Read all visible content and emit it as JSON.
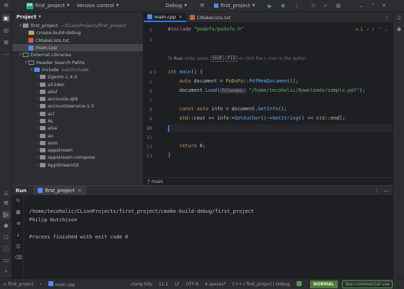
{
  "titlebar": {
    "project_badge": "FP",
    "project_name": "first_project",
    "vcs": "Version control",
    "config": "Debug",
    "run_target": "first_project"
  },
  "project_panel": {
    "title": "Project",
    "tree": [
      {
        "label": "first_project",
        "extra": "~/CLionProjects/first_project",
        "kind": "folder"
      },
      {
        "label": "cmake-build-debug",
        "kind": "folder-orange"
      },
      {
        "label": "CMakeLists.txt",
        "kind": "cmake"
      },
      {
        "label": "main.cpp",
        "kind": "cpp"
      },
      {
        "label": "External Libraries",
        "kind": "lib"
      },
      {
        "label": "Header Search Paths",
        "kind": "lib"
      },
      {
        "label": "include",
        "extra": "/usr/include",
        "kind": "folder-blue"
      },
      {
        "label": "2geom-1.4.0",
        "kind": "folder"
      },
      {
        "label": "a52dec",
        "kind": "folder"
      },
      {
        "label": "absl",
        "kind": "folder"
      },
      {
        "label": "accounts-qt6",
        "kind": "folder"
      },
      {
        "label": "accountsservice-1.0",
        "kind": "folder"
      },
      {
        "label": "acl",
        "kind": "folder"
      },
      {
        "label": "AL",
        "kind": "folder"
      },
      {
        "label": "alsa",
        "kind": "folder"
      },
      {
        "label": "ao",
        "kind": "folder"
      },
      {
        "label": "aom",
        "kind": "folder"
      },
      {
        "label": "appstream",
        "kind": "folder"
      },
      {
        "label": "appstream-compose",
        "kind": "folder"
      },
      {
        "label": "AppStreamQt",
        "kind": "folder"
      }
    ]
  },
  "editor": {
    "tabs": [
      {
        "label": "main.cpp",
        "active": true
      },
      {
        "label": "CMakeLists.txt",
        "active": false
      }
    ],
    "banner": {
      "pre": "To ",
      "bold": "Run",
      "mid": " code, press ",
      "key1": "Shift",
      "key2": "F10",
      "post": " or click the ▷ icon in the gutter."
    },
    "inspections": {
      "warnings": "1",
      "weak": "1"
    },
    "lines": [
      "2",
      "3",
      "4",
      "5",
      "6",
      "7",
      "8",
      "9",
      "10",
      "11",
      "12",
      "13"
    ],
    "code": {
      "include_kw": "#include",
      "include_str": "\"podofo/podofo.h\"",
      "l4_type": "int",
      "l4_fn": "main",
      "l4_rest": "() {",
      "l5_kw": "auto",
      "l5_var": "document = ",
      "l5_ns": "PoDoFo",
      "l5_sep": "::",
      "l5_fn": "PdfMemDocument",
      "l5_end": "();",
      "l6_obj": "document.",
      "l6_fn": "Load",
      "l6_open": "(",
      "l6_hint": "filename:",
      "l6_str": "\"/home/tecoholic/Downloads/sample.pdf\"",
      "l6_end": ");",
      "l8_kw": "const auto",
      "l8_var": "info = document.",
      "l8_fn": "GetInfo",
      "l8_end": "();",
      "l9_ns": "std",
      "l9_a": "::cout << info->",
      "l9_fn1": "GetAuthor",
      "l9_b": "()->",
      "l9_fn2": "GetString",
      "l9_c": "() << ",
      "l9_ns2": "std",
      "l9_d": "::endl;",
      "l12_kw": "return",
      "l12_rest": " 0;",
      "l13": "}"
    },
    "breadcrumb": "main"
  },
  "run_panel": {
    "title": "Run",
    "tab": "first_project",
    "output": [
      "/home/tecoholic/CLionProjects/first_project/cmake-build-debug/first_project",
      "Philip Hutchison",
      "",
      "Process finished with exit code 0"
    ]
  },
  "statusbar": {
    "project": "first_project",
    "file": "main.cpp",
    "clang_tidy": ".clang-tidy",
    "position": "11:1",
    "line_sep": "LF",
    "encoding": "UTF-8",
    "indent": "4 spaces*",
    "context": "C++ | first_project | Debug",
    "mode": "NORMAL",
    "license": "Non-commercial use"
  },
  "colors": {
    "accent": "#3574f0",
    "run_green": "#57965c",
    "badge": "#25a38a"
  }
}
